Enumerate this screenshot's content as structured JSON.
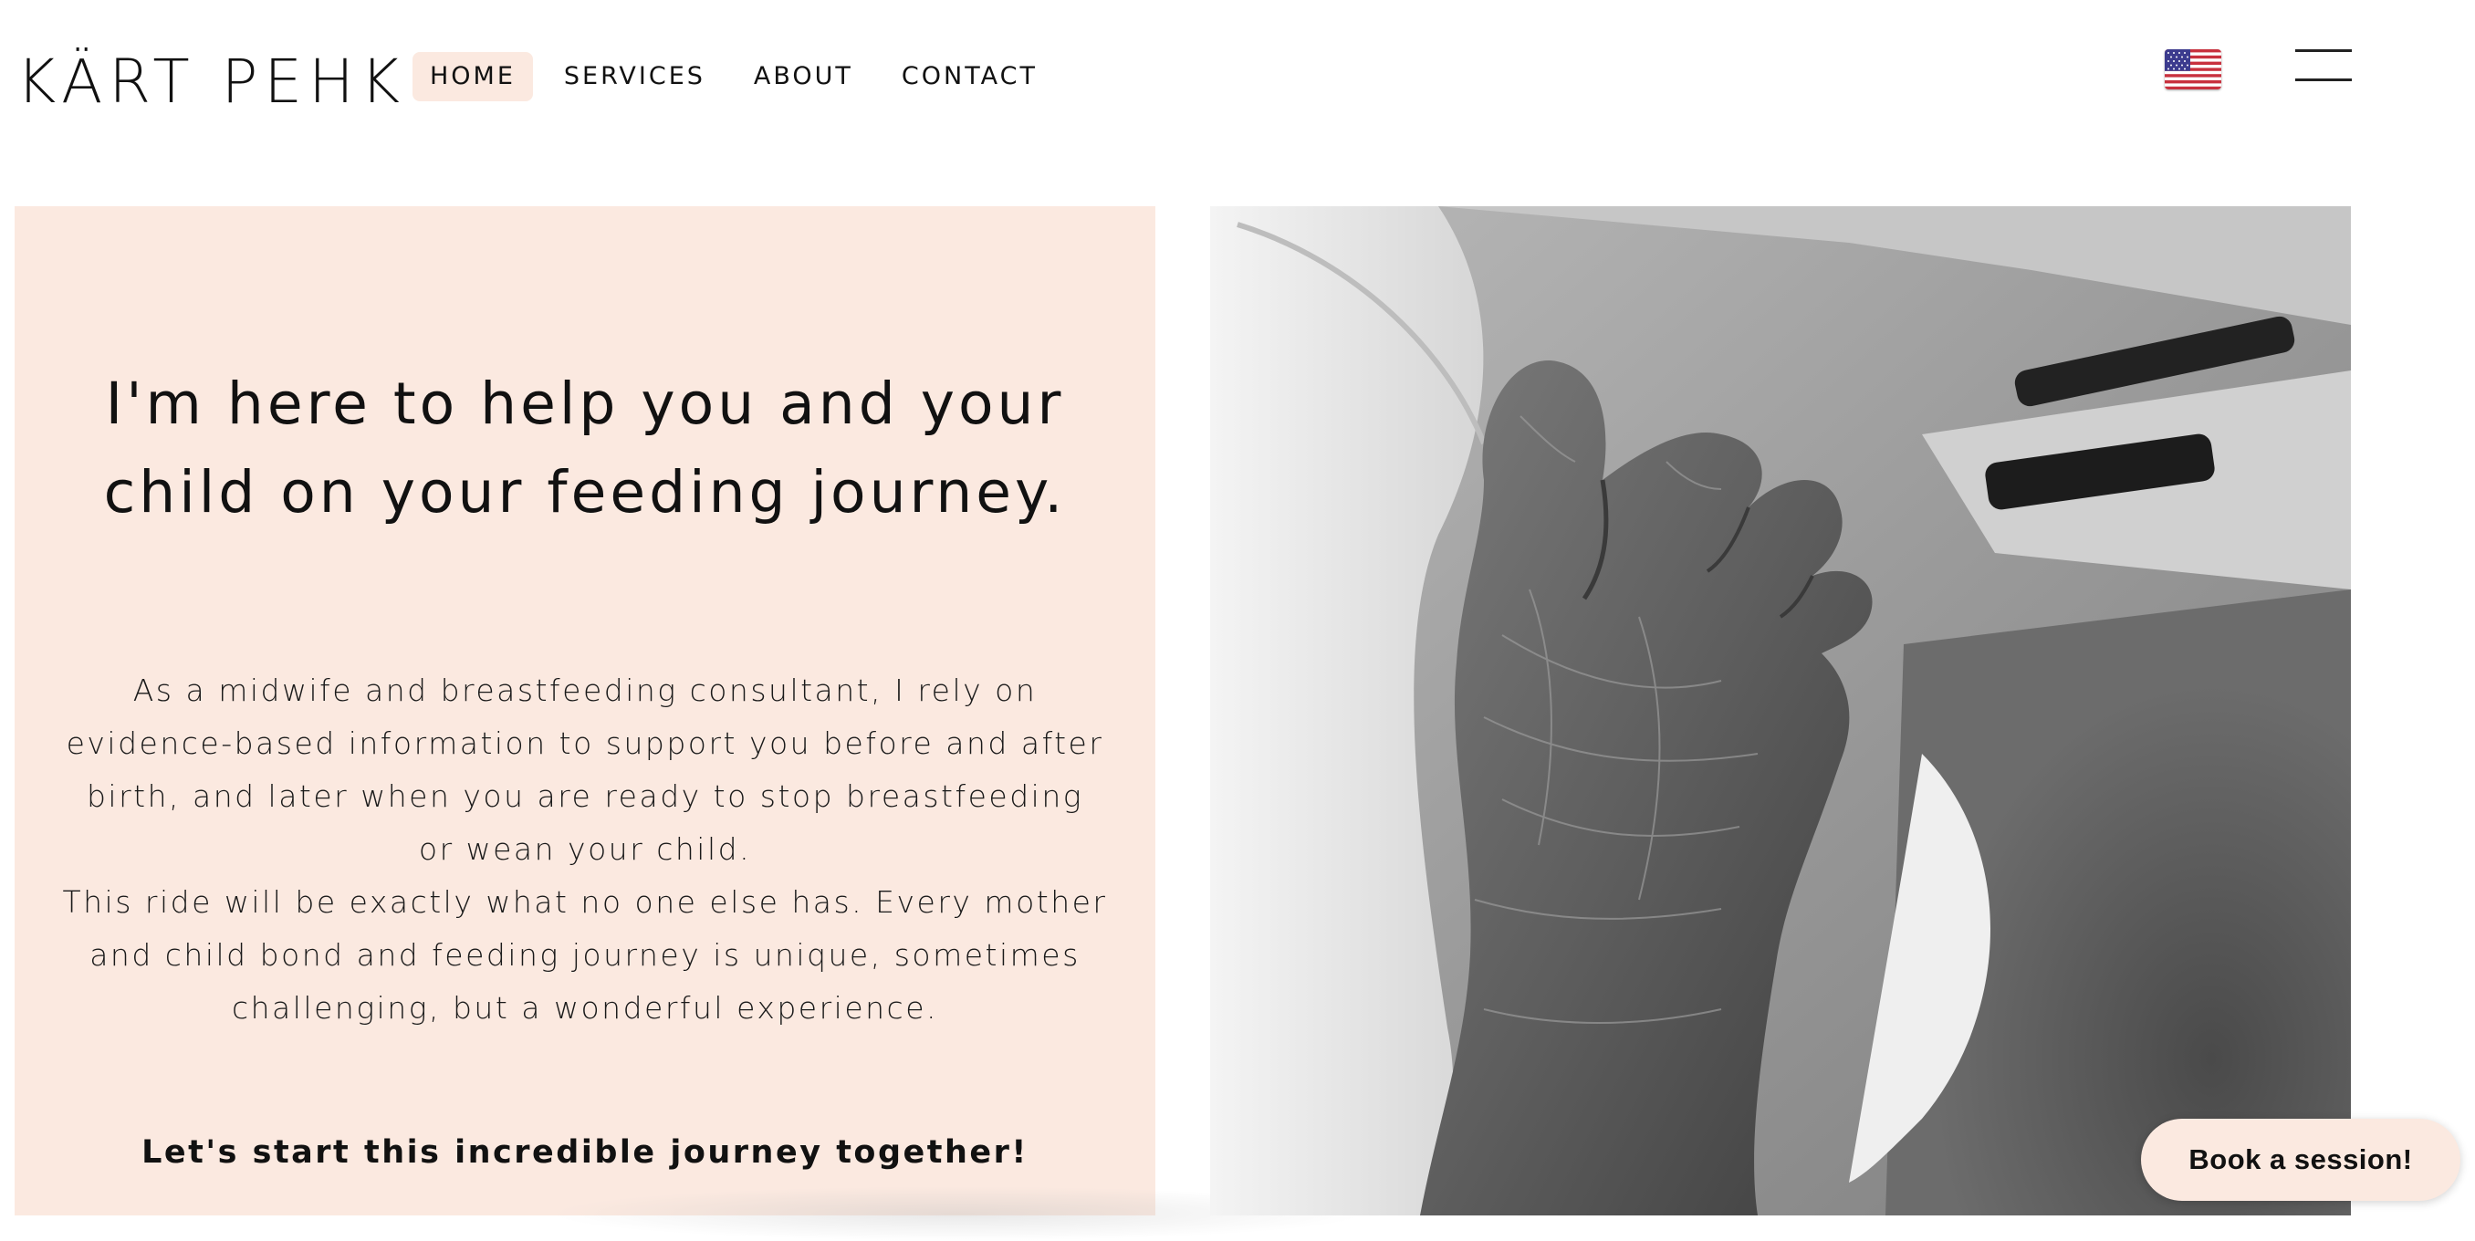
{
  "header": {
    "logo": "KÄRT PEHK",
    "nav": [
      {
        "label": "HOME",
        "active": true
      },
      {
        "label": "SERVICES",
        "active": false
      },
      {
        "label": "ABOUT",
        "active": false
      },
      {
        "label": "CONTACT",
        "active": false
      }
    ],
    "language_flag_icon": "us-flag-icon",
    "menu_icon": "hamburger-menu-icon"
  },
  "hero": {
    "heading_lines": [
      "I'm here to help you and your",
      "child on your feeding journey."
    ],
    "body_lines": [
      "As a midwife and breastfeeding consultant, I rely on",
      "evidence-based information to support you before and after",
      "birth, and later when you are ready to stop breastfeeding",
      "or wean your child.",
      "This ride will be exactly what no one else has. Every mother",
      "and child bond and feeding journey is unique, sometimes",
      "challenging, but a wonderful experience."
    ],
    "cta_text": "Let's start this incredible journey together!",
    "photo_description_icon": "baby-foot-photo"
  },
  "floating_button": {
    "label": "Book a session!"
  },
  "colors": {
    "panel_background": "#fbe9e0",
    "active_nav_background": "#fbe9e0",
    "text": "#111111",
    "page_background": "#ffffff"
  }
}
